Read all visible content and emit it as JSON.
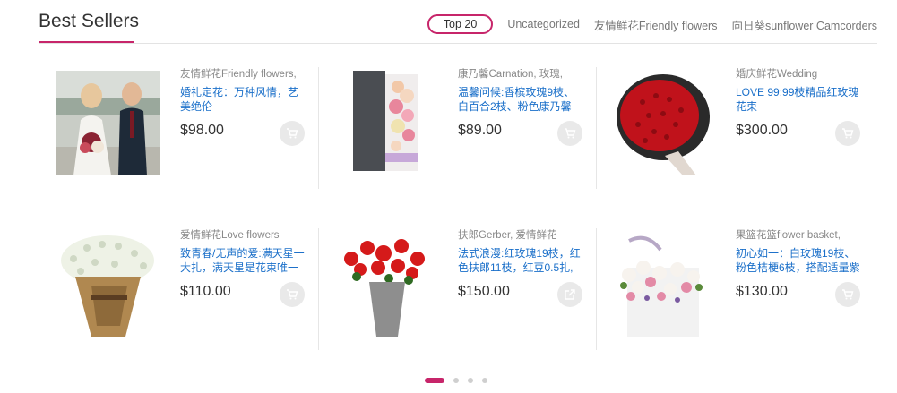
{
  "section": {
    "title": "Best Sellers"
  },
  "tabs": [
    {
      "label": "Top 20",
      "active": true
    },
    {
      "label": "Uncategorized"
    },
    {
      "label": "友情鲜花Friendly flowers"
    },
    {
      "label": "向日葵sunflower Camcorders"
    }
  ],
  "products": [
    {
      "category": "友情鲜花Friendly flowers,",
      "name": "婚礼定花：万种风情，艺美绝伦",
      "price": "$98.00",
      "icon": "add-to-cart-icon",
      "image": "wedding-couple-bouquet"
    },
    {
      "category": "康乃馨Carnation, 玫瑰,",
      "name": "温馨问候:香槟玫瑰9枝、白百合2枝、粉色康乃馨",
      "price": "$89.00",
      "icon": "add-to-cart-icon",
      "image": "gift-box-flowers"
    },
    {
      "category": "婚庆鲜花Wedding",
      "name": "LOVE 99:99枝精品红玫瑰花束",
      "price": "$300.00",
      "icon": "add-to-cart-icon",
      "image": "red-rose-bouquet"
    },
    {
      "category": "爱情鲜花Love flowers",
      "name": "致青春/无声的爱:满天星一大扎，满天星是花束唯一",
      "price": "$110.00",
      "icon": "add-to-cart-icon",
      "image": "baby-breath-bouquet"
    },
    {
      "category": "扶郎Gerber, 爱情鲜花",
      "name": "法式浪漫:红玫瑰19枝，红色扶郎11枝，红豆0.5扎,",
      "price": "$150.00",
      "icon": "external-link-icon",
      "image": "red-gerbera-vase"
    },
    {
      "category": "果篮花篮flower basket,",
      "name": "初心如一：白玫瑰19枝、粉色桔梗6枝，搭配适量紫",
      "price": "$130.00",
      "icon": "add-to-cart-icon",
      "image": "flower-basket"
    }
  ],
  "pagination": {
    "count": 4,
    "active": 0
  }
}
